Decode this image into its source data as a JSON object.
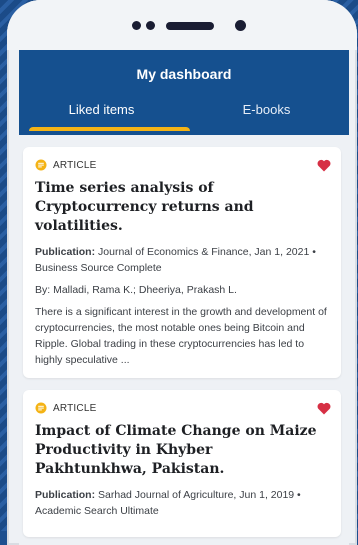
{
  "header": {
    "title": "My dashboard",
    "tabs": [
      {
        "label": "Liked items",
        "active": true
      },
      {
        "label": "E-books",
        "active": false
      }
    ]
  },
  "colors": {
    "header_bg": "#15508f",
    "tab_indicator": "#f4b315",
    "heart": "#d62f44",
    "article_icon": "#f4b315"
  },
  "items": [
    {
      "type": "ARTICLE",
      "title": "Time series analysis of Cryptocurrency returns and volatilities.",
      "publication_label": "Publication:",
      "publication": "Journal of Economics & Finance, Jan 1, 2021 • Business Source Complete",
      "authors_label": "By:",
      "authors": "Malladi, Rama K.; Dheeriya, Prakash L.",
      "abstract": "There is a significant interest in the growth and development of cryptocurrencies, the most notable ones being Bitcoin and Ripple. Global trading in these cryptocurrencies has led to highly speculative ...",
      "liked": true
    },
    {
      "type": "ARTICLE",
      "title": "Impact of Climate Change on Maize Productivity in Khyber Pakhtunkhwa, Pakistan.",
      "publication_label": "Publication:",
      "publication": "Sarhad Journal of Agriculture, Jun 1, 2019 • Academic Search Ultimate",
      "liked": true
    }
  ]
}
